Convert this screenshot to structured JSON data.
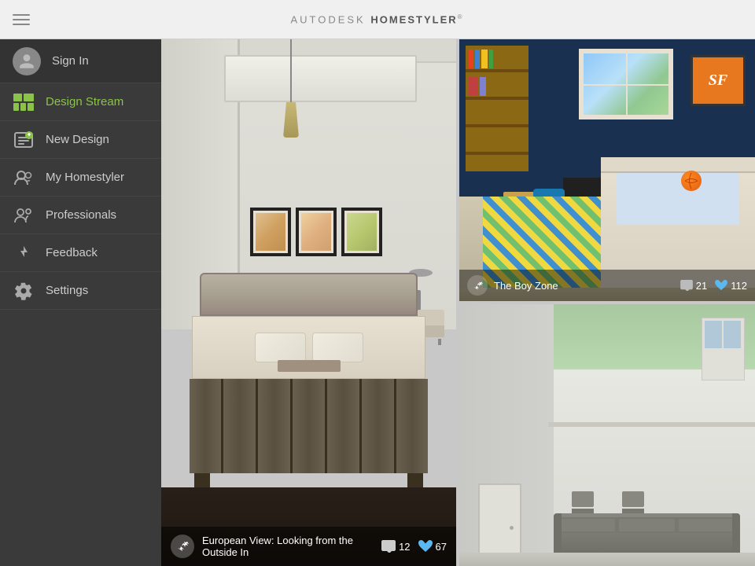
{
  "header": {
    "title_prefix": "AUTODESK",
    "title_main": "HOMESTYLER",
    "title_super": "®",
    "menu_icon_label": "hamburger-menu"
  },
  "sidebar": {
    "signin_label": "Sign In",
    "items": [
      {
        "id": "design-stream",
        "label": "Design Stream",
        "active": true
      },
      {
        "id": "new-design",
        "label": "New Design",
        "active": false
      },
      {
        "id": "my-homestyler",
        "label": "My Homestyler",
        "active": false
      },
      {
        "id": "professionals",
        "label": "Professionals",
        "active": false
      },
      {
        "id": "feedback",
        "label": "Feedback",
        "active": false
      },
      {
        "id": "settings",
        "label": "Settings",
        "active": false
      }
    ]
  },
  "panels": {
    "left": {
      "caption_text": "European View: Looking from the Outside In",
      "comments_count": "12",
      "likes_count": "67"
    },
    "top_right": {
      "title": "The Boy Zone",
      "comments_count": "21",
      "likes_count": "112",
      "sf_sign_text": "SF"
    },
    "bottom_right": {
      "caption_text": ""
    }
  },
  "icons": {
    "wand": "✦",
    "comment": "💬",
    "heart": "♥",
    "grid": "⊞",
    "pencil": "✏",
    "person": "👤",
    "star": "★",
    "feedback_icon": "⬆",
    "settings_icon": "⚙"
  },
  "colors": {
    "sidebar_bg": "#3a3a3a",
    "active_green": "#8bc34a",
    "header_bg": "#f0f0f0",
    "caption_bg": "rgba(0,0,0,0.55)"
  }
}
